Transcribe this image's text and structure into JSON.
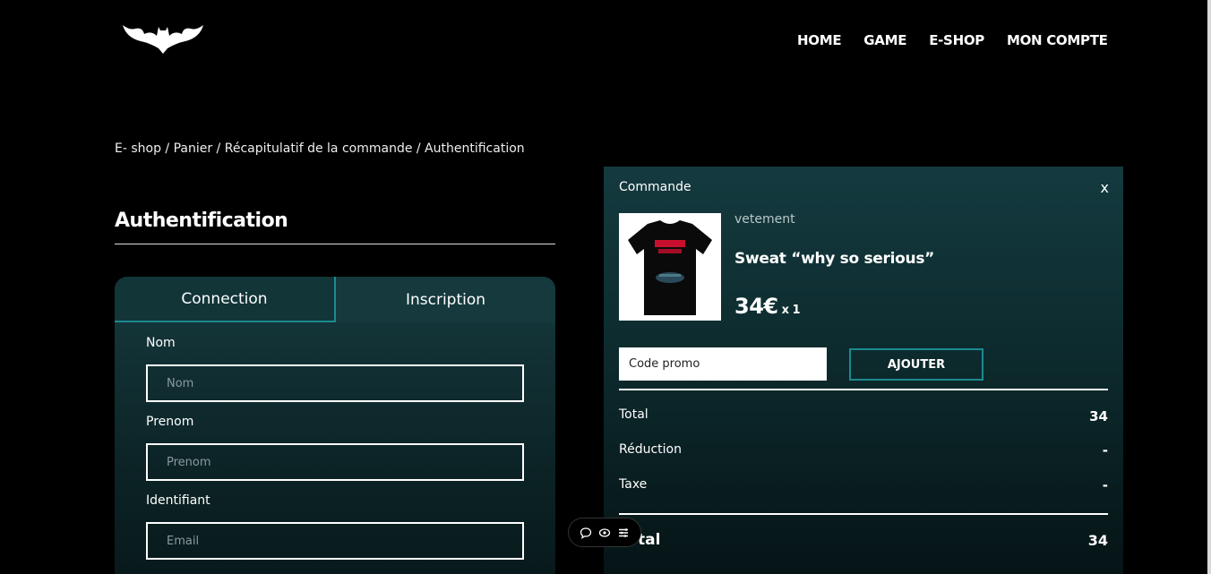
{
  "nav": {
    "items": [
      "HOME",
      "GAME",
      "E-SHOP",
      "MON COMPTE"
    ]
  },
  "breadcrumb": "E- shop / Panier / Récapitulatif de la commande / Authentification",
  "page_title": "Authentification",
  "auth": {
    "tabs": [
      "Connection",
      "Inscription"
    ],
    "fields": [
      {
        "label": "Nom",
        "placeholder": "Nom"
      },
      {
        "label": "Prenom",
        "placeholder": "Prenom"
      },
      {
        "label": "Identifiant",
        "placeholder": "Email"
      }
    ]
  },
  "order": {
    "title": "Commande",
    "close_label": "x",
    "product": {
      "category": "vetement",
      "name": "Sweat “why so serious”",
      "price": "34€",
      "qty": "x 1"
    },
    "promo_placeholder": "Code promo",
    "add_label": "AJOUTER",
    "summary": [
      {
        "label": "Total",
        "value": "34"
      },
      {
        "label": "Réduction",
        "value": "-"
      },
      {
        "label": "Taxe",
        "value": "-"
      }
    ],
    "grand_total": {
      "label": "Total",
      "value": "34"
    }
  },
  "colors": {
    "accent": "#1c8a90",
    "panel": "#143a3f",
    "background": "#000000"
  },
  "icons": [
    "bat-logo-icon",
    "comment-icon",
    "eye-icon",
    "menu-list-icon"
  ]
}
